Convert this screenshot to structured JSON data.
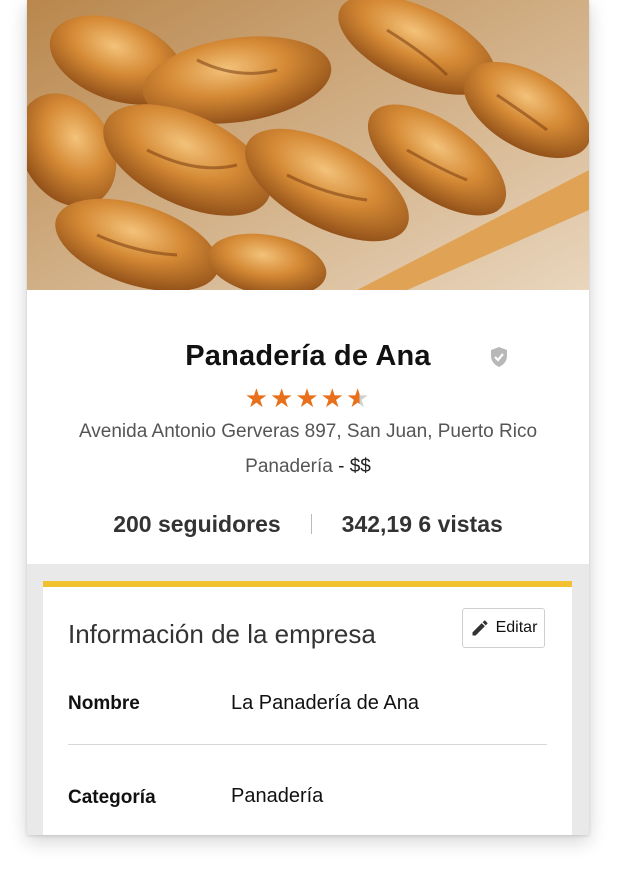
{
  "business": {
    "name": "Panadería de Ana",
    "rating": 4.5,
    "stars": [
      "★",
      "★",
      "★",
      "★",
      "★"
    ],
    "address": "Avenida Antonio Gerveras 897, San Juan, Puerto Rico",
    "category": "Panadería",
    "separator": " - ",
    "price": "$$"
  },
  "stats": {
    "followers": "200 seguidores",
    "views": "342,19 6 vistas"
  },
  "info": {
    "title": "Información de la empresa",
    "edit_label": "Editar",
    "rows": [
      {
        "label": "Nombre",
        "value": "La Panadería de Ana"
      },
      {
        "label": "Categoría",
        "value": "Panadería"
      }
    ]
  },
  "colors": {
    "star": "#e8701a",
    "accent_bar": "#f2c12e"
  },
  "icons": {
    "verified": "shield-check-icon",
    "edit": "pencil-icon"
  }
}
